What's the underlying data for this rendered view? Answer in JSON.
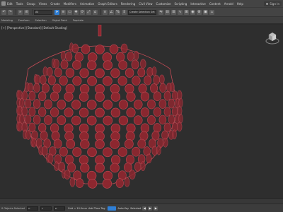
{
  "menu": {
    "items": [
      "Edit",
      "Tools",
      "Group",
      "Views",
      "Create",
      "Modifiers",
      "Animation",
      "Graph Editors",
      "Rendering",
      "Civil View",
      "Customize",
      "Scripting",
      "Interactive",
      "Content",
      "Arnold",
      "Help"
    ],
    "signin_label": "Sign In"
  },
  "toolbar": {
    "filter_value": "All",
    "selection_set_value": "Create Selection Set"
  },
  "ribbon": {
    "tabs": [
      "Modeling",
      "Freeform",
      "Selection",
      "Object Paint",
      "Populate"
    ]
  },
  "viewport": {
    "label": "[+] [Perspective] [Standard] [Default Shading]"
  },
  "status": {
    "left_text": "0 Objects Selected",
    "x_label": "X:",
    "y_label": "Y:",
    "z_label": "Z:",
    "grid_readout": "Grid = 10.0mm",
    "add_time_tag": "Add Time Tag",
    "auto_key": "Auto Key",
    "selected": "Selected"
  },
  "colors": {
    "accent": "#2f7fd6",
    "model_fill": "#8e2730",
    "model_edge": "#c24b55",
    "viewport_bg": "#2e2e2e"
  },
  "icons": [
    "app-logo-icon",
    "undo-icon",
    "redo-icon",
    "link-icon",
    "select-icon",
    "move-icon",
    "rotate-icon",
    "scale-icon",
    "snap-icon",
    "viewcube-icon",
    "play-icon",
    "key-icon"
  ]
}
